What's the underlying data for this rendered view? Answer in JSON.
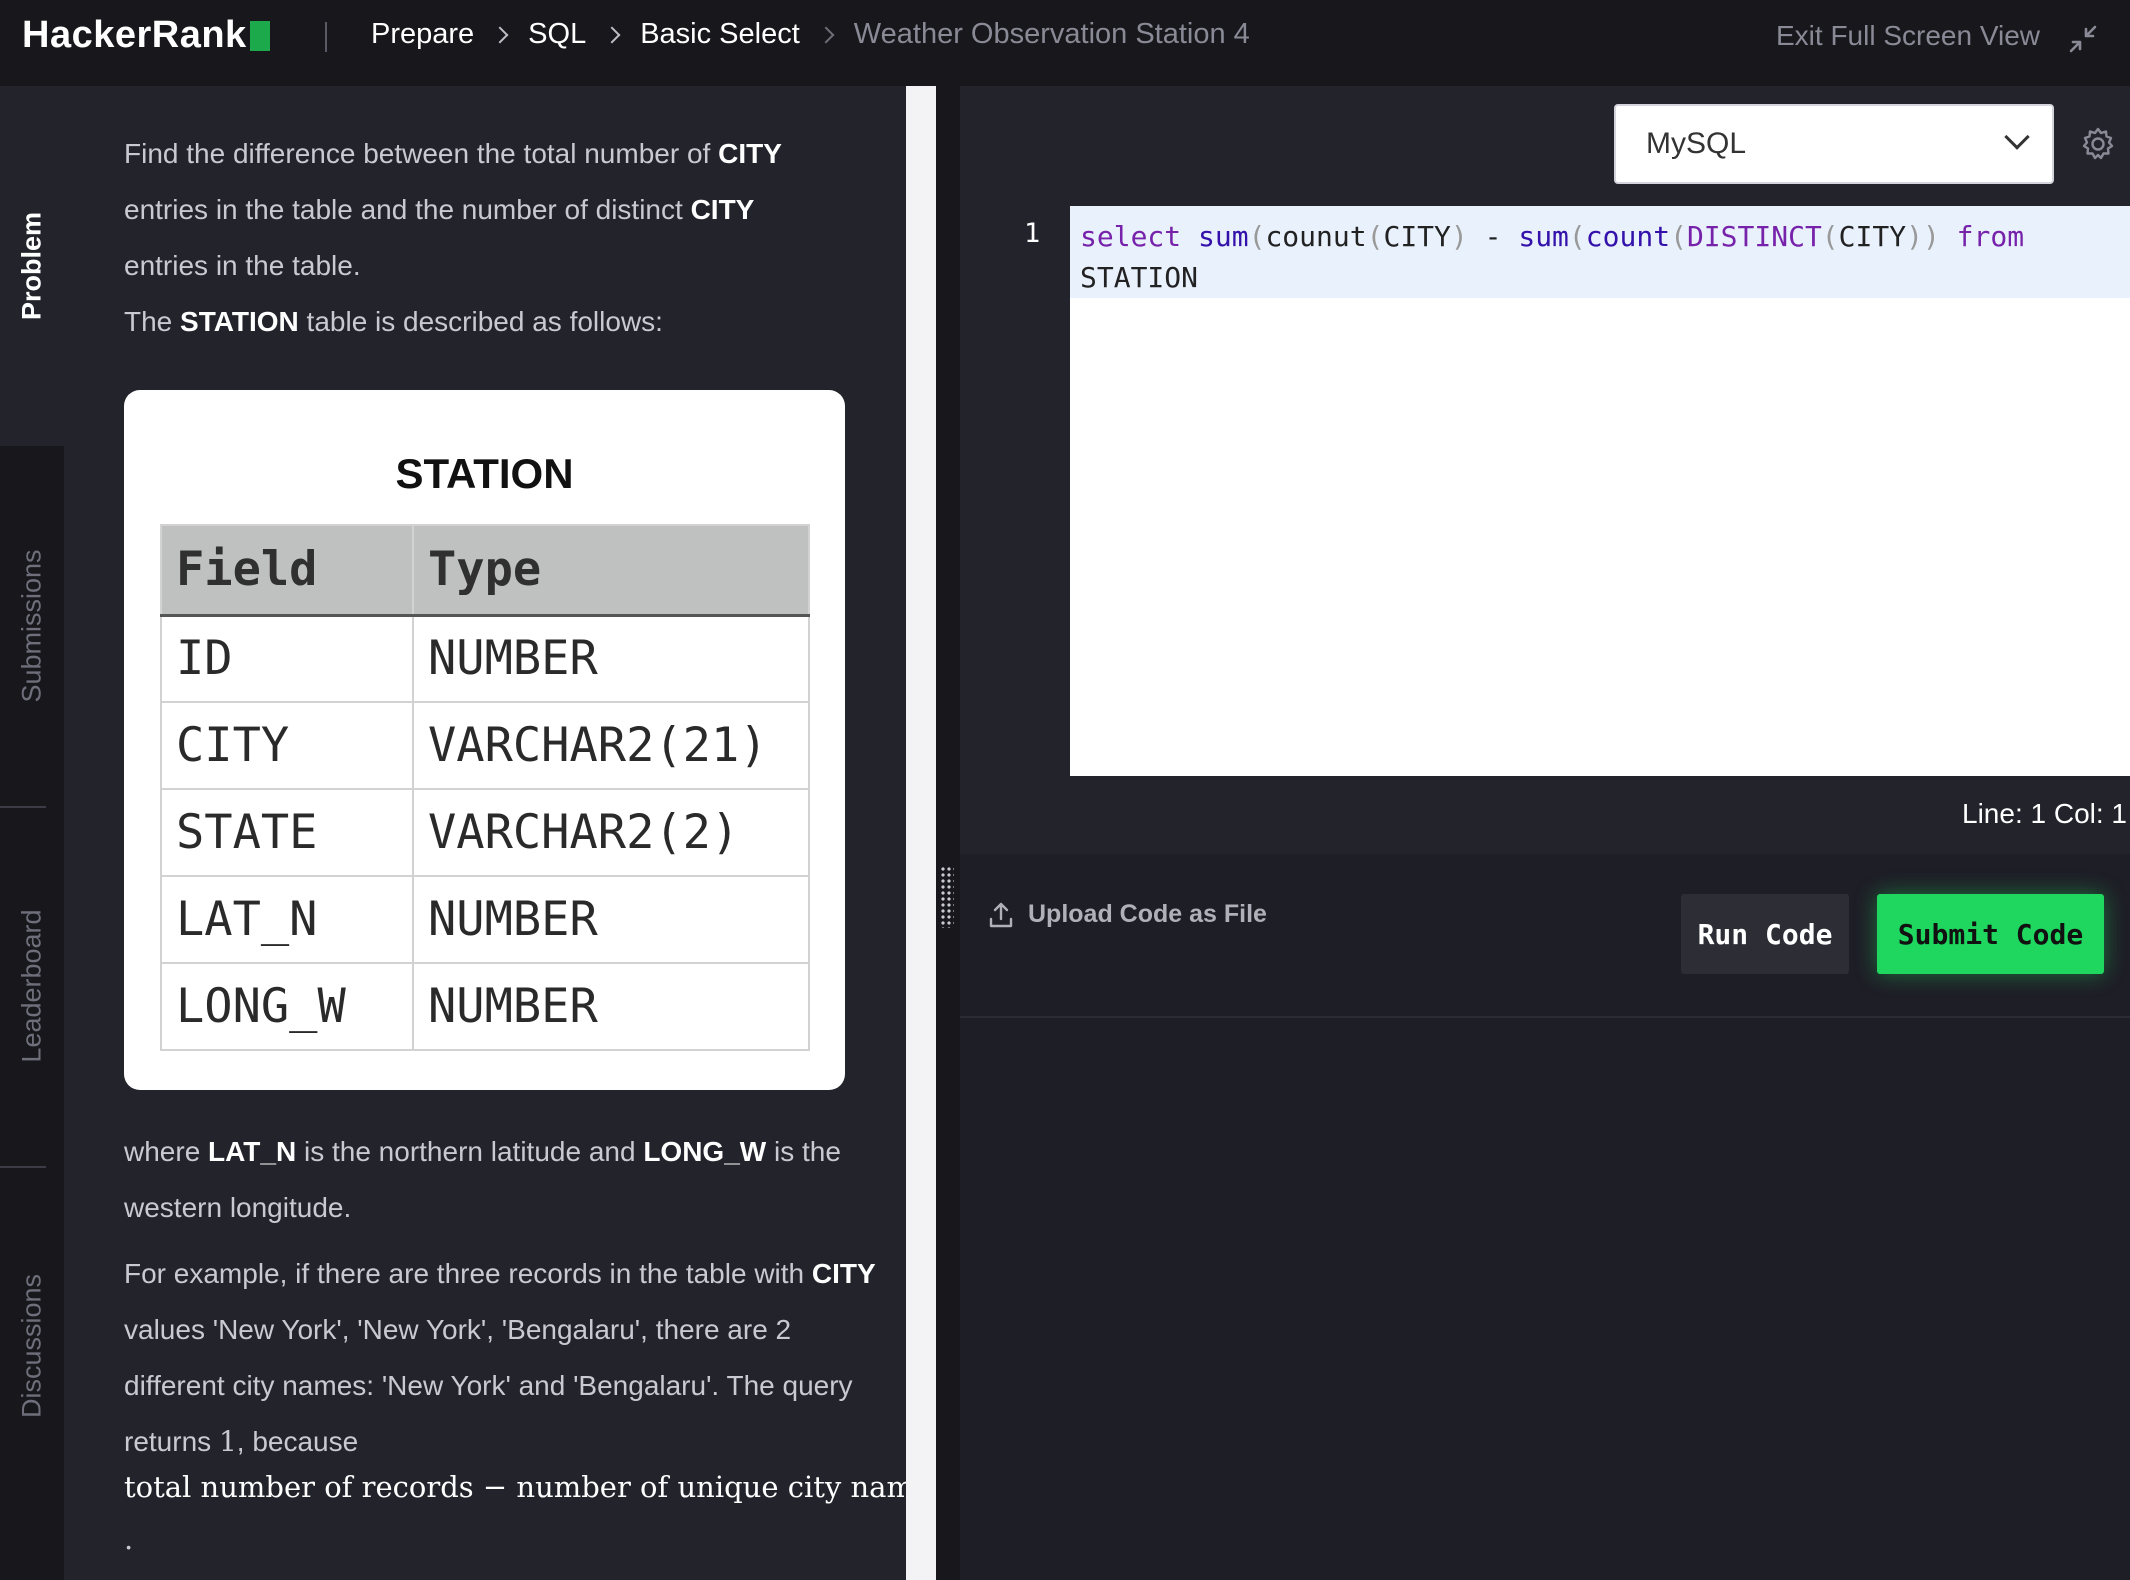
{
  "header": {
    "logo_text": "HackerRank",
    "breadcrumbs": [
      "Prepare",
      "SQL",
      "Basic Select",
      "Weather Observation Station 4"
    ],
    "exit_fullscreen": "Exit Full Screen View"
  },
  "sidebar": {
    "tabs": [
      "Problem",
      "Submissions",
      "Leaderboard",
      "Discussions"
    ]
  },
  "problem": {
    "p1_a": "Find the difference between the total number of ",
    "p1_b": "CITY",
    "p1_c": " entries in the table and the number of distinct ",
    "p1_d": "CITY",
    "p1_e": " entries in the table.",
    "p2_a": "The ",
    "p2_b": "STATION",
    "p2_c": " table is described as follows:",
    "table": {
      "title": "STATION",
      "headers": [
        "Field",
        "Type"
      ],
      "rows": [
        [
          "ID",
          "NUMBER"
        ],
        [
          "CITY",
          "VARCHAR2(21)"
        ],
        [
          "STATE",
          "VARCHAR2(2)"
        ],
        [
          "LAT_N",
          "NUMBER"
        ],
        [
          "LONG_W",
          "NUMBER"
        ]
      ]
    },
    "p3_a": "where ",
    "p3_b": "LAT_N",
    "p3_c": " is the northern latitude and ",
    "p3_d": "LONG_W",
    "p3_e": " is the western longitude.",
    "p4_a": "For example, if there are three records in the table with ",
    "p4_b": "CITY",
    "p4_c": " values 'New York', 'New York', 'Bengalaru', there are 2 different city names: 'New York' and 'Bengalaru'. The query returns ",
    "p4_d": "1",
    "p4_e": ", because",
    "formula": "total number of records − number of unique city names =",
    "trailing": "."
  },
  "editor": {
    "language": "MySQL",
    "line_number": "1",
    "code_tokens": {
      "t1": "select",
      "t2": "sum",
      "t3": "(",
      "t4": "counut",
      "t5": "(",
      "t6": "CITY",
      "t7": ")",
      "t8": " - ",
      "t9": "sum",
      "t10": "(",
      "t11": "count",
      "t12": "(",
      "t13": "DISTINCT",
      "t14": "(",
      "t15": "CITY",
      "t16": "))",
      "t17": "from",
      "t18": "STATION"
    },
    "cursor_position": "Line: 1 Col: 1"
  },
  "actions": {
    "upload": "Upload Code as File",
    "run": "Run Code",
    "submit": "Submit Code"
  },
  "colors": {
    "brand_green": "#1ba94c",
    "submit_green": "#1fd65f",
    "keyword": "#7722aa"
  }
}
